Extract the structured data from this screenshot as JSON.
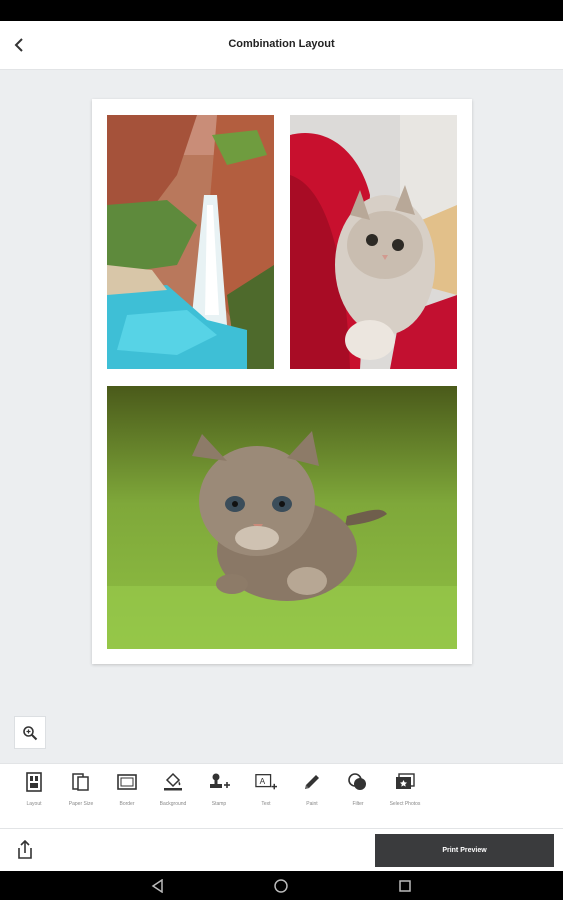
{
  "header": {
    "title": "Combination Layout"
  },
  "photos": [
    {
      "subject": "waterfall"
    },
    {
      "subject": "cat on red cushion"
    },
    {
      "subject": "kitten on grass"
    }
  ],
  "toolbar": {
    "items": [
      {
        "label": "Layout",
        "icon": "layout-icon"
      },
      {
        "label": "Paper Size",
        "icon": "paper-size-icon"
      },
      {
        "label": "Border",
        "icon": "border-icon"
      },
      {
        "label": "Background",
        "icon": "background-icon"
      },
      {
        "label": "Stamp",
        "icon": "stamp-icon"
      },
      {
        "label": "Text",
        "icon": "text-icon"
      },
      {
        "label": "Paint",
        "icon": "paint-icon"
      },
      {
        "label": "Filter",
        "icon": "filter-icon"
      },
      {
        "label": "Select Photos",
        "icon": "select-photos-icon"
      }
    ]
  },
  "footer": {
    "print_label": "Print Preview"
  },
  "colors": {
    "accent": "#3a3b3d",
    "icon": "#333333"
  }
}
